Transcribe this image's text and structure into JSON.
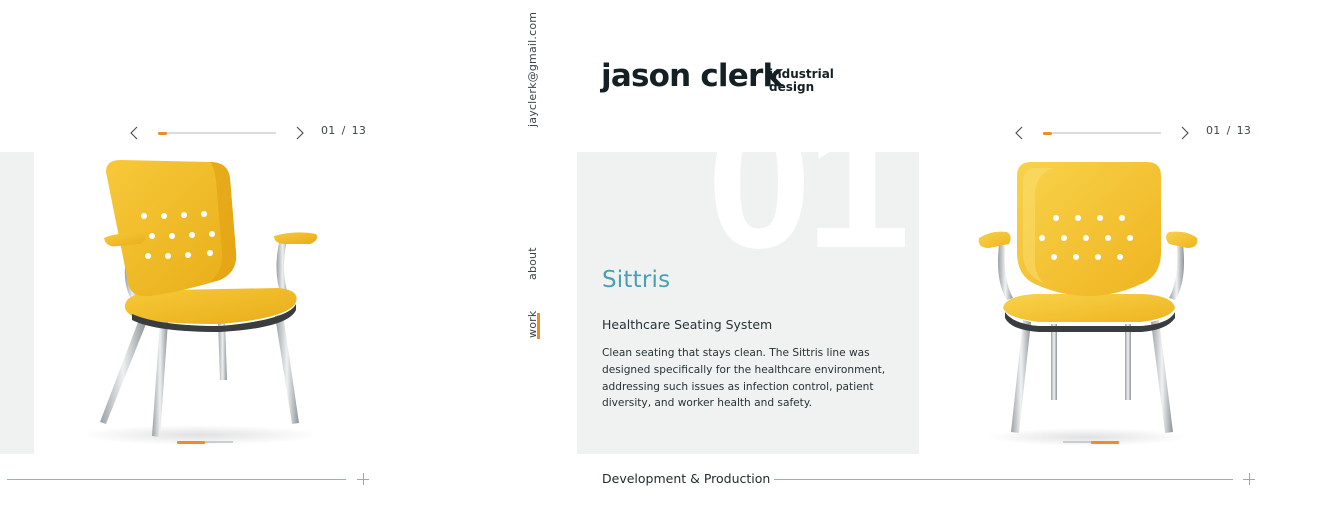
{
  "contact": {
    "email": "jayclerk@gmail.com"
  },
  "logo": {
    "name": "jason clerk",
    "tagline_line1": "industrial",
    "tagline_line2": "design"
  },
  "nav": {
    "about": "about",
    "work": "work"
  },
  "slider": {
    "current": "01",
    "separator": "/",
    "total": "13",
    "progress": 0.08
  },
  "project": {
    "number": "01",
    "title": "Sittris",
    "subtitle": "Healthcare Seating System",
    "description": "Clean seating that stays clean. The Sittris line was designed specifically for the healthcare environment, addressing such issues as infection control, patient diversity, and worker health and safety."
  },
  "section": {
    "label": "Development & Production"
  },
  "colors": {
    "accent": "#f08c28",
    "title_teal": "#4a9fb4",
    "panel_bg": "#f0f2f2",
    "chair_yellow": "#f5c22e",
    "rule": "#8fb3c2"
  },
  "icons": {
    "prev": "chevron-left-icon",
    "next": "chevron-right-icon",
    "expand": "plus-icon"
  }
}
